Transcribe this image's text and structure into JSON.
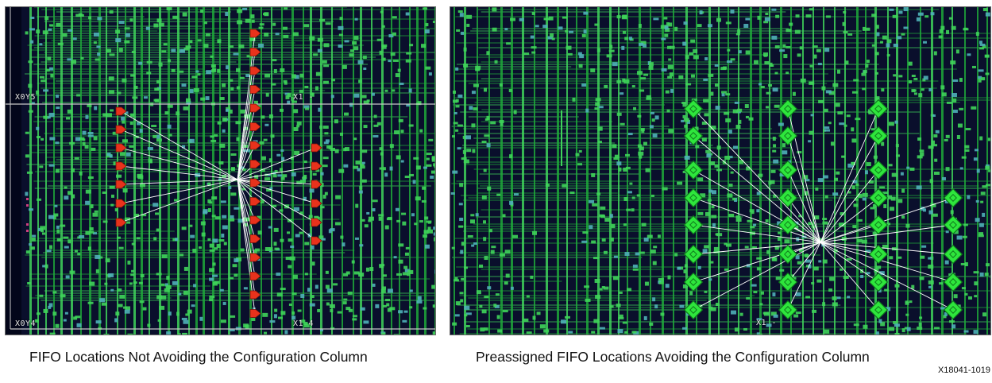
{
  "colors": {
    "background": "#0a0f2c",
    "logic_green": "#1fa83a",
    "bright_green": "#3fd45a",
    "cell_teal": "#4fb0b8",
    "fifo_unavoided": "#e8321c",
    "fifo_avoided": "#2ee63c",
    "net_line": "#ffffff",
    "region_border": "#c8c8c8"
  },
  "left_panel": {
    "region_labels": [
      "X0Y5",
      "X1 -",
      "X0Y4",
      "X1 4"
    ],
    "fifo_icon": "red-arrow-marker-icon",
    "fifo_count": 24
  },
  "right_panel": {
    "region_labels": [
      "X1 -"
    ],
    "fifo_icon": "green-diamond-marker-icon",
    "fifo_count": 31
  },
  "captions": {
    "left": "FIFO Locations Not Avoiding the Configuration Column",
    "right": "Preassigned FIFO Locations Avoiding the Configuration Column"
  },
  "figure_id": "X18041-1019"
}
